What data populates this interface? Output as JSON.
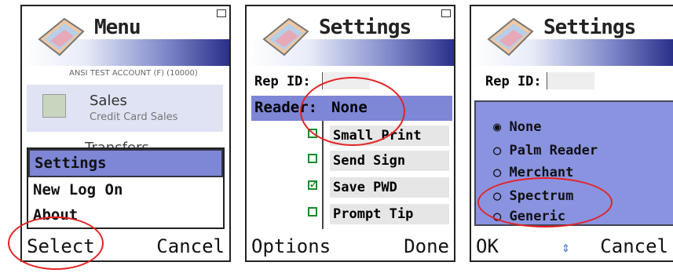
{
  "screens": [
    {
      "title": "Menu",
      "account": "ANSI TEST ACCOUNT (F) (10000)",
      "items": [
        {
          "label": "Sales",
          "sublabel": "Credit Card Sales"
        },
        {
          "label": "Transfers"
        }
      ],
      "popup": [
        "Settings",
        "New Log On",
        "About"
      ],
      "softkeys": {
        "left": "Select",
        "right": "Cancel"
      }
    },
    {
      "title": "Settings",
      "rep_id_label": "Rep ID:",
      "reader_label": "Reader:",
      "reader_value": "None",
      "options": [
        {
          "label": "Small Print",
          "checked": false
        },
        {
          "label": "Send Sign",
          "checked": false
        },
        {
          "label": "Save PWD",
          "checked": true
        },
        {
          "label": "Prompt Tip",
          "checked": false
        }
      ],
      "softkeys": {
        "left": "Options",
        "right": "Done"
      }
    },
    {
      "title": "Settings",
      "rep_id_label": "Rep ID:",
      "radio_options": [
        {
          "label": "None",
          "selected": true
        },
        {
          "label": "Palm Reader",
          "selected": false
        },
        {
          "label": "Merchant",
          "selected": false
        },
        {
          "label": "Spectrum",
          "selected": false
        },
        {
          "label": "Generic",
          "selected": false
        }
      ],
      "softkeys": {
        "left": "OK",
        "middle": "⇕",
        "right": "Cancel"
      }
    }
  ],
  "colors": {
    "highlight": "#7e86d6",
    "annotation": "#e52222",
    "check": "#1a8a2a"
  }
}
